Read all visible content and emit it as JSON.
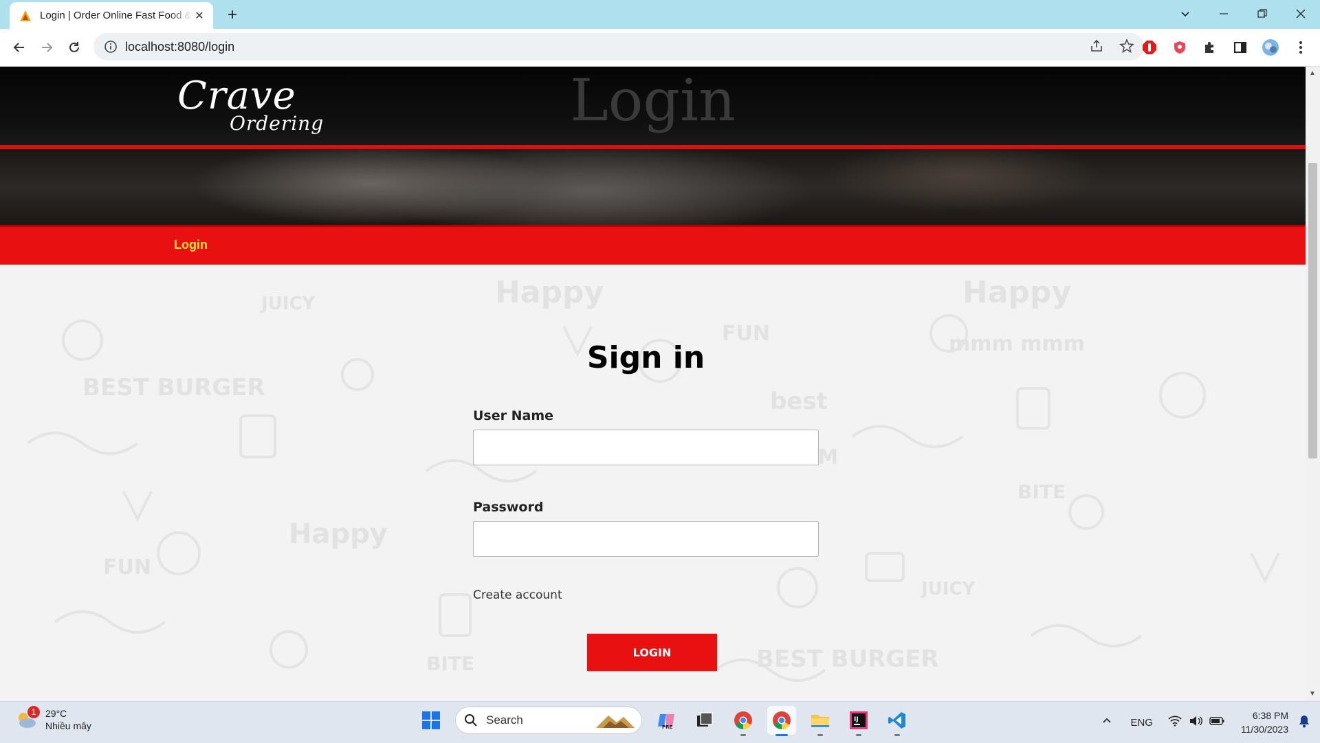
{
  "browser": {
    "tab_title": "Login | Order Online Fast Food & Drinks",
    "url": "localhost:8080/login"
  },
  "page": {
    "logo_line1": "Crave",
    "logo_line2": "Ordering",
    "heading": "Login",
    "nav": {
      "login": "Login"
    }
  },
  "form": {
    "title": "Sign in",
    "username_label": "User Name",
    "username_value": "",
    "password_label": "Password",
    "password_value": "",
    "create_account": "Create account",
    "login_button": "LOGIN"
  },
  "taskbar": {
    "weather_temp": "29°C",
    "weather_desc": "Nhiều mây",
    "weather_badge": "1",
    "search_label": "Search",
    "language": "ENG",
    "time": "6:38 PM",
    "date": "11/30/2023"
  },
  "colors": {
    "brand_red": "#e81010",
    "nav_text": "#ffe23a",
    "tabbar": "#aee0ee"
  }
}
